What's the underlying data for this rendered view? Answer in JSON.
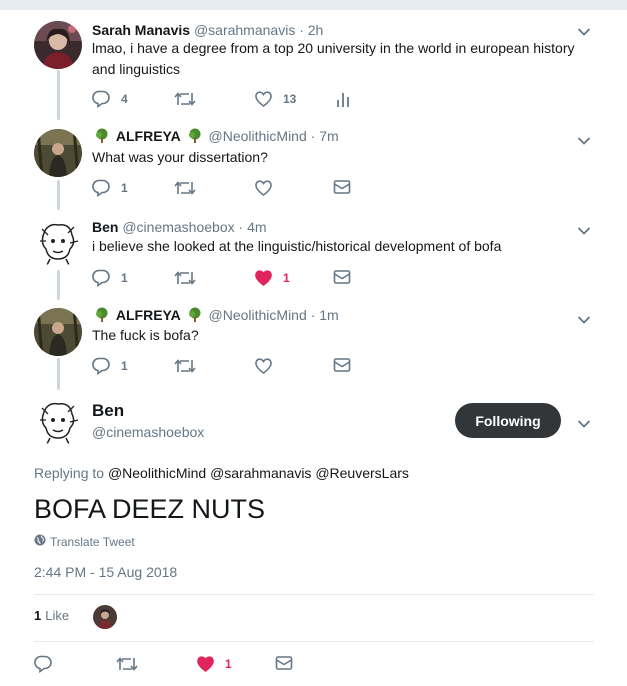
{
  "tweets": [
    {
      "name": "Sarah Manavis",
      "handle": "@sarahmanavis",
      "time": "· 2h",
      "text": "lmao, i have a degree from a top 20 university in the world in european history and linguistics",
      "replies": "4",
      "retweets": "",
      "likes": "13",
      "liked": false
    },
    {
      "name": "ALFREYA",
      "handle": "@NeolithicMind",
      "time": "· 7m",
      "text": "What was your dissertation?",
      "replies": "1",
      "retweets": "",
      "likes": "",
      "liked": false
    },
    {
      "name": "Ben",
      "handle": "@cinemashoebox",
      "time": "· 4m",
      "text": "i believe she looked at the linguistic/historical development of bofa",
      "replies": "1",
      "retweets": "",
      "likes": "1",
      "liked": true
    },
    {
      "name": "ALFREYA",
      "handle": "@NeolithicMind",
      "time": "· 1m",
      "text": "The fuck is bofa?",
      "replies": "1",
      "retweets": "",
      "likes": "",
      "liked": false
    }
  ],
  "main_tweet": {
    "name": "Ben",
    "handle": "@cinemashoebox",
    "follow_label": "Following",
    "replying_prefix": "Replying to",
    "replying_to": "@NeolithicMind @sarahmanavis @ReuversLars",
    "text": "BOFA DEEZ NUTS",
    "translate_label": "Translate Tweet",
    "timestamp": "2:44 PM - 15 Aug 2018",
    "like_count": "1",
    "like_label": "Like",
    "footer_likes": "1"
  },
  "icons": {
    "reply": "reply-icon",
    "retweet": "retweet-icon",
    "like": "heart-icon",
    "analytics": "analytics-icon",
    "dm": "envelope-icon",
    "more": "chevron-down-icon",
    "globe": "globe-icon",
    "tree": "tree-emoji-icon"
  },
  "colors": {
    "text": "#14171a",
    "secondary": "#657786",
    "liked": "#e0245e",
    "button": "#333638",
    "thread_line": "#ccd6dd"
  }
}
